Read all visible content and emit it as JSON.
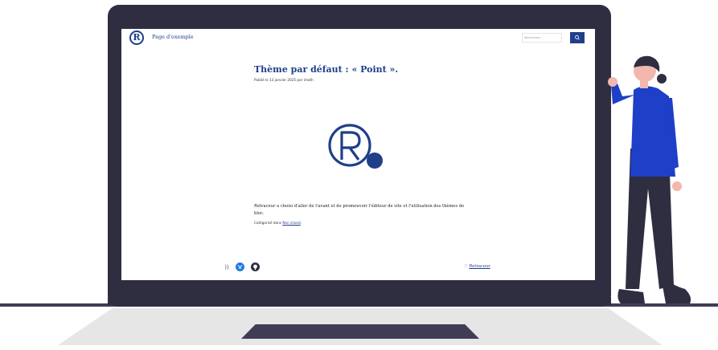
{
  "header": {
    "site_title": "Page d'exemple",
    "search_placeholder": "Rechercher…"
  },
  "post": {
    "title": "Thème par défaut : « Point ».",
    "meta": "Publié le 13 janvier 2025 par imath",
    "body": "Retraceur a choisi d'aller de l'avant et de promouvoir l'éditeur de site et l'utilisation des thèmes de bloc.",
    "categories_prefix": "Catégorisé dans",
    "category_link": "Non classé",
    "categories_suffix": "."
  },
  "footer": {
    "heart": "♡",
    "credit_link": "Retraceur",
    "rss_glyph": "))"
  },
  "icons": [
    "site-logo-icon",
    "search-icon",
    "rss-icon",
    "bluesky-icon",
    "github-icon",
    "heart-icon"
  ],
  "colors": {
    "accent": "#1f3f8a",
    "laptop": "#2f2e41",
    "person_shirt": "#1e3fc8",
    "person_skin": "#f2b7ad"
  }
}
